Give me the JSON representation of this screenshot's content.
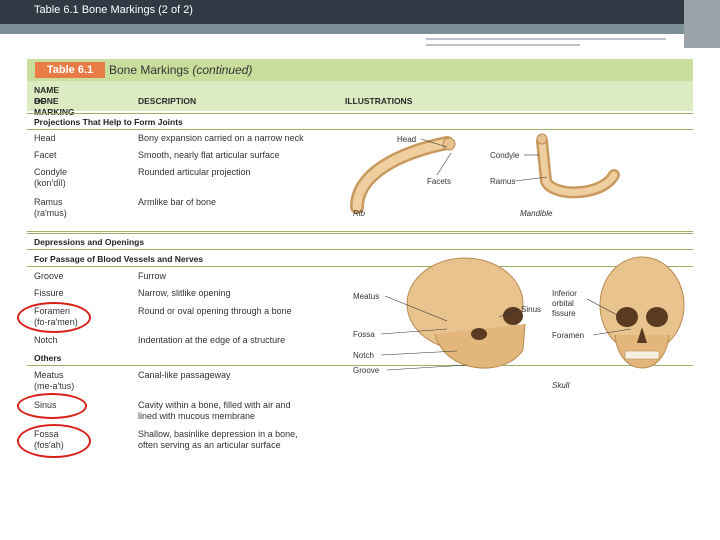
{
  "slide": {
    "title": "Table 6.1  Bone Markings (2 of 2)"
  },
  "table": {
    "label": "Table 6.1",
    "title": "Bone Markings",
    "title_suffix": "(continued)",
    "headers": {
      "name_line1": "NAME OF",
      "name_line2": "BONE MARKING",
      "description": "DESCRIPTION",
      "illustrations": "ILLUSTRATIONS"
    },
    "joints": {
      "section": "Projections That Help to Form Joints",
      "rows": [
        {
          "name": "Head",
          "pron": "",
          "desc": "Bony expansion carried on a narrow neck"
        },
        {
          "name": "Facet",
          "pron": "",
          "desc": "Smooth, nearly flat articular surface"
        },
        {
          "name": "Condyle",
          "pron": "(kon′dīl)",
          "desc": "Rounded articular projection"
        },
        {
          "name": "Ramus",
          "pron": "(ra′mus)",
          "desc": "Armlike bar of bone"
        }
      ]
    },
    "depressions": {
      "section": "Depressions and Openings",
      "subsection": "For Passage of Blood Vessels and Nerves",
      "rows": [
        {
          "name": "Groove",
          "pron": "",
          "desc": "Furrow"
        },
        {
          "name": "Fissure",
          "pron": "",
          "desc": "Narrow, slitlike opening"
        },
        {
          "name": "Foramen",
          "pron": "(fo-ra′men)",
          "desc": "Round or oval opening through a bone"
        },
        {
          "name": "Notch",
          "pron": "",
          "desc": "Indentation at the edge of a structure"
        }
      ],
      "others_label": "Others",
      "others": [
        {
          "name": "Meatus",
          "pron": "(me-a′tus)",
          "desc": "Canal-like passageway",
          "desc2": ""
        },
        {
          "name": "Sinus",
          "pron": "",
          "desc": "Cavity within a bone, filled with air and",
          "desc2": "lined with mucous membrane"
        },
        {
          "name": "Fossa",
          "pron": "(fos′ah)",
          "desc": "Shallow, basinlike depression in a bone,",
          "desc2": "often serving as an articular surface"
        }
      ]
    },
    "illustrations": {
      "rib_labels": {
        "head": "Head",
        "facets": "Facets",
        "caption": "Rib"
      },
      "mandible_labels": {
        "condyle": "Condyle",
        "ramus": "Ramus",
        "caption": "Mandible"
      },
      "skull_side_labels": {
        "meatus": "Meatus",
        "sinus": "Sinus",
        "fossa": "Fossa",
        "notch": "Notch",
        "groove": "Groove"
      },
      "skull_front_labels": {
        "fissure_1": "Inferior",
        "fissure_2": "orbital",
        "fissure_3": "fissure",
        "foramen": "Foramen",
        "caption": "Skull"
      }
    }
  },
  "colors": {
    "header_dark": "#2f3a45",
    "band": "#7d8f96",
    "table_head": "#c9dd9c",
    "label_orange": "#e87b46",
    "bone": "#e9c38e",
    "circle": "#d9211a"
  }
}
